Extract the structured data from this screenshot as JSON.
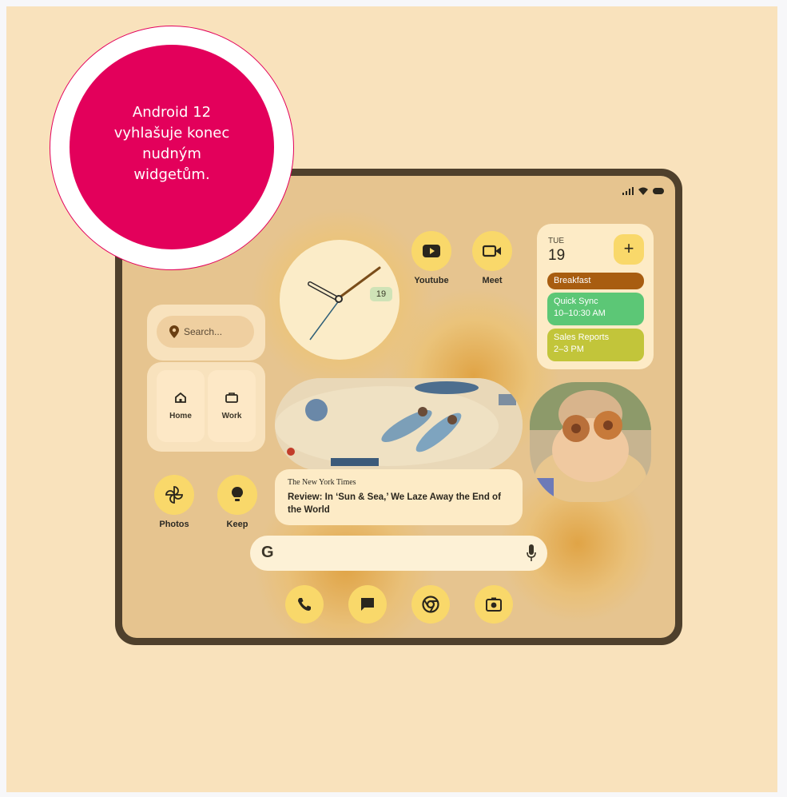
{
  "badge": {
    "line1": "Android 12",
    "line2": "vyhlašuje konec",
    "line3": "nudným",
    "line4": "widgetům.",
    "color": "#e3005b"
  },
  "clock": {
    "date": "19"
  },
  "apps": {
    "youtube": {
      "label": "Youtube",
      "icon": "youtube-icon"
    },
    "meet": {
      "label": "Meet",
      "icon": "video-camera-icon"
    },
    "photos": {
      "label": "Photos",
      "icon": "pinwheel-icon"
    },
    "keep": {
      "label": "Keep",
      "icon": "lightbulb-icon"
    }
  },
  "search_widget": {
    "placeholder": "Search...",
    "places": [
      {
        "label": "Home",
        "icon": "home-icon"
      },
      {
        "label": "Work",
        "icon": "briefcase-icon"
      }
    ]
  },
  "calendar": {
    "weekday": "TUE",
    "day": "19",
    "add": "+",
    "events": [
      {
        "title": "Breakfast",
        "time": "",
        "color": "#a85d10"
      },
      {
        "title": "Quick Sync",
        "time": "10–10:30 AM",
        "color": "#5cc776"
      },
      {
        "title": "Sales Reports",
        "time": "2–3 PM",
        "color": "#c2c53a"
      }
    ]
  },
  "news": {
    "source": "The New York Times",
    "headline": "Review: In ‘Sun & Sea,’ We Laze Away the End of the World"
  },
  "google_bar": {
    "logo": "G"
  },
  "dock": [
    {
      "icon": "phone-icon"
    },
    {
      "icon": "messages-icon"
    },
    {
      "icon": "chrome-icon"
    },
    {
      "icon": "camera-icon"
    }
  ],
  "colors": {
    "background": "#f9e2bc",
    "frame": "#4f402c",
    "accent": "#f9d86a"
  }
}
